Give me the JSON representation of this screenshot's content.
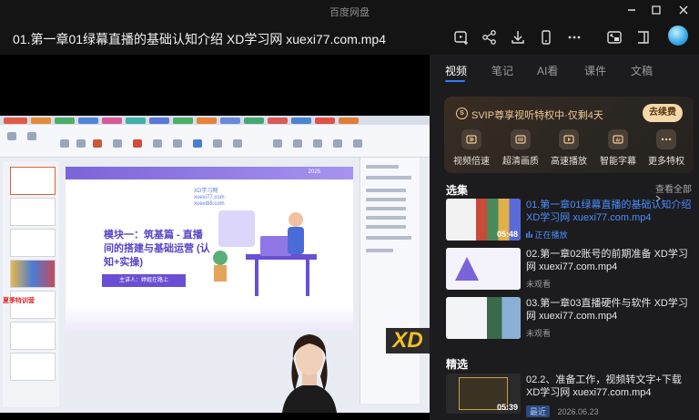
{
  "window": {
    "app_title": "百度网盘"
  },
  "toolbar": {
    "video_title": "01.第一章01绿幕直播的基础认知介绍 XD学习网 xuexi77.com.mp4"
  },
  "tabs": [
    "视频",
    "笔记",
    "AI看",
    "课件",
    "文稿"
  ],
  "svip": {
    "title": "SVIP尊享视听特权中·仅剩4天",
    "renew_label": "去续费",
    "features": [
      "视频倍速",
      "超清画质",
      "高速播放",
      "智能字幕",
      "更多特权"
    ]
  },
  "playlist": {
    "title": "选集",
    "see_all": "查看全部",
    "items": [
      {
        "title": "01.第一章01绿幕直播的基础认知介绍 XD学习网 xuexi77.com.mp4",
        "status": "正在播放",
        "duration": "05:48"
      },
      {
        "title": "02.第一章02账号的前期准备 XD学习网 xuexi77.com.mp4",
        "status": "未观看"
      },
      {
        "title": "03.第一章03直播硬件与软件 XD学习网 xuexi77.com.mp4",
        "status": "未观看"
      }
    ]
  },
  "featured": {
    "title": "精选",
    "items": [
      {
        "title": "02.2、准备工作，视频转文字+下载 XD学习网 xuexi77.com.mp4",
        "badge": "最近",
        "date": "2026.06.23",
        "duration": "05:39"
      }
    ]
  },
  "slide": {
    "year": "2025",
    "heading": "模块一：筑基篇 - 直播间的搭建与基础运营 (认知+实操)",
    "presenter": "主讲人：婷姐在路上",
    "watermark": "XD学习网\nxuexi77.com\nxuexi88.com",
    "left_tag": "夏季特训营",
    "logo": "XD"
  }
}
